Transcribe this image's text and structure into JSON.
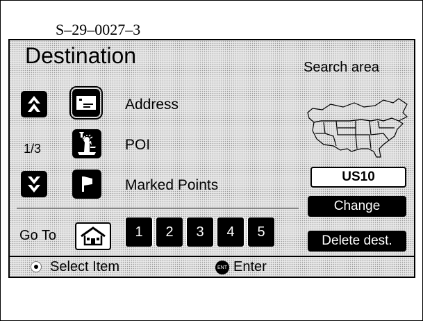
{
  "figure_code": "S–29–0027–3",
  "screen": {
    "title": "Destination",
    "search_area_label": "Search area",
    "page_indicator": "1/3",
    "menu_items": [
      {
        "label": "Address",
        "icon": "address-card-icon"
      },
      {
        "label": "POI",
        "icon": "statue-of-liberty-icon"
      },
      {
        "label": "Marked Points",
        "icon": "flag-icon"
      }
    ],
    "goto": {
      "label": "Go To",
      "home_icon": "home-icon",
      "numbers": [
        "1",
        "2",
        "3",
        "4",
        "5"
      ]
    },
    "region": "US10",
    "change_button": "Change",
    "delete_button": "Delete dest.",
    "status": {
      "select_label": "Select Item",
      "enter_label": "Enter",
      "enter_icon_text": "ENT"
    },
    "scroll_up_icon": "double-chevron-up-icon",
    "scroll_down_icon": "double-chevron-down-icon",
    "map_icon": "north-america-map-icon"
  }
}
